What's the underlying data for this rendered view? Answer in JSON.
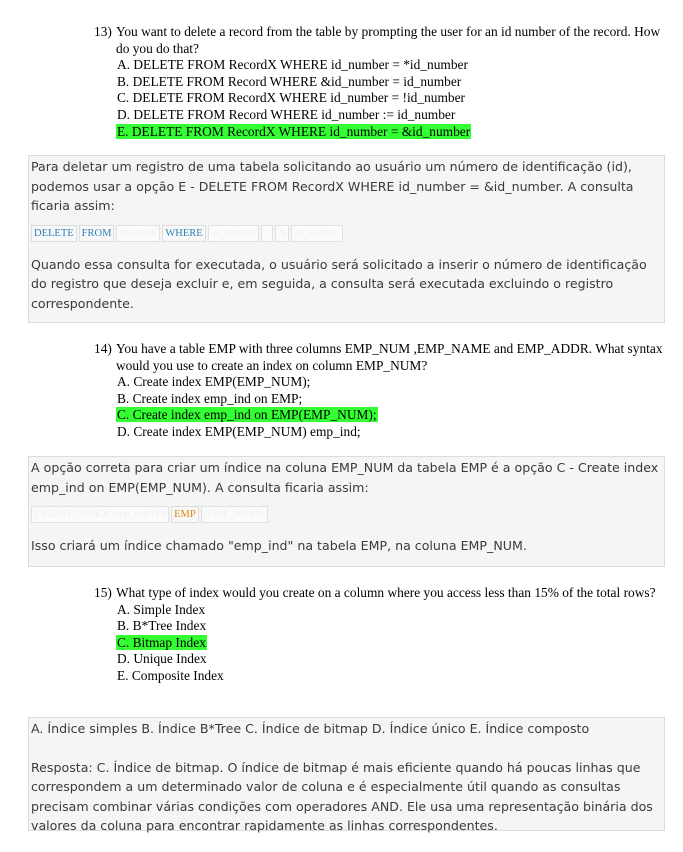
{
  "q13": {
    "number": "13)",
    "text": "You want to delete a record from the table by prompting the user for an id number of the record. How do you do that?",
    "options": [
      "A. DELETE FROM RecordX WHERE id_number = *id_number",
      "B. DELETE FROM Record WHERE &id_number = id_number",
      "C. DELETE FROM RecordX WHERE id_number = !id_number",
      "D. DELETE FROM Record WHERE id_number := id_number",
      "E. DELETE FROM RecordX WHERE id_number = &id_number"
    ],
    "answer_index": 4
  },
  "a13": {
    "intro": "Para deletar um registro de uma tabela solicitando ao usuário um número de identificação (id), podemos usar a opção E - DELETE FROM RecordX WHERE id_number = &id_number. A consulta ficaria assim:",
    "code_tokens": [
      {
        "text": "DELETE",
        "style": "kw"
      },
      {
        "text": "FROM",
        "style": "kw"
      },
      {
        "text": "RecordX",
        "style": "faint"
      },
      {
        "text": "WHERE",
        "style": "kw"
      },
      {
        "text": "id_number",
        "style": "faint"
      },
      {
        "text": "=",
        "style": "faint"
      },
      {
        "text": "&",
        "style": "faint"
      },
      {
        "text": "id_number",
        "style": "faint"
      }
    ],
    "outro": "Quando essa consulta for executada, o usuário será solicitado a inserir o número de identificação do registro que deseja excluir e, em seguida, a consulta será executada excluindo o registro correspondente."
  },
  "q14": {
    "number": "14)",
    "text": "You have a table EMP with three columns EMP_NUM ,EMP_NAME and EMP_ADDR. What syntax would you use to create an index on column EMP_NUM?",
    "options": [
      "A. Create index EMP(EMP_NUM);",
      "B. Create index emp_ind on EMP;",
      "C. Create index emp_ind on EMP(EMP_NUM);",
      "D. Create index EMP(EMP_NUM) emp_ind;"
    ],
    "answer_index": 2
  },
  "a14": {
    "intro": "A opção correta para criar um índice na coluna EMP_NUM da tabela EMP é a opção C - Create index emp_ind on EMP(EMP_NUM). A consulta ficaria assim:",
    "code_tokens": [
      {
        "text": "CREATE INDEX emp_ind ON",
        "style": "faint"
      },
      {
        "text": "EMP",
        "style": "kw2"
      },
      {
        "text": "(EMP_NUM);",
        "style": "faint"
      }
    ],
    "outro": "Isso criará um índice chamado \"emp_ind\" na tabela EMP, na coluna EMP_NUM."
  },
  "q15": {
    "number": "15)",
    "text": "What type of index would you create on a column where you access less than 15% of the total rows?",
    "options": [
      "A. Simple Index",
      "B. B*Tree Index",
      "C. Bitmap Index",
      "D. Unique Index",
      "E. Composite Index"
    ],
    "answer_index": 2
  },
  "a15": {
    "intro": "A. Índice simples B. Índice B*Tree C. Índice de bitmap D. Índice único E. Índice composto",
    "outro": "Resposta: C. Índice de bitmap. O índice de bitmap é mais eficiente quando há poucas linhas que correspondem a um determinado valor de coluna e é especialmente útil quando as consultas precisam combinar várias condições com operadores AND. Ele usa uma representação binária dos valores da coluna para encontrar rapidamente as linhas correspondentes."
  },
  "colors": {
    "highlight": "#33ff33",
    "keyword": "#2a7fb8",
    "keyword_alt": "#d98a1a",
    "answer_bg": "#f5f5f5"
  }
}
